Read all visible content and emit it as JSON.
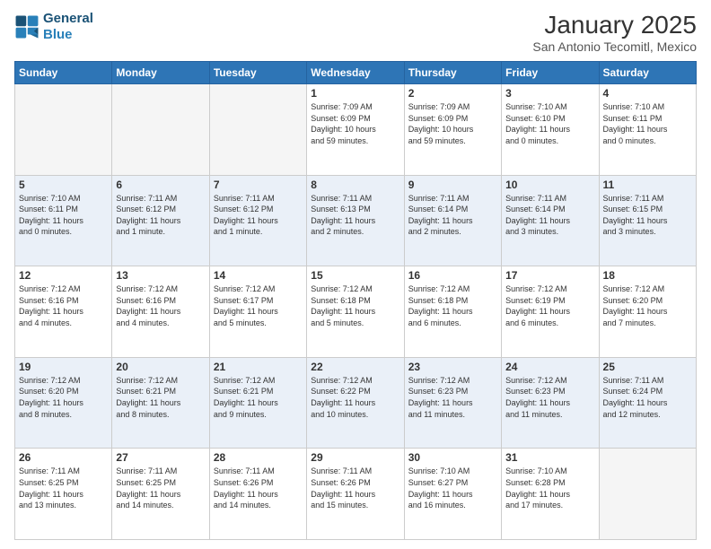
{
  "logo": {
    "line1": "General",
    "line2": "Blue"
  },
  "title": "January 2025",
  "subtitle": "San Antonio Tecomitl, Mexico",
  "weekdays": [
    "Sunday",
    "Monday",
    "Tuesday",
    "Wednesday",
    "Thursday",
    "Friday",
    "Saturday"
  ],
  "rows": [
    [
      {
        "day": "",
        "info": ""
      },
      {
        "day": "",
        "info": ""
      },
      {
        "day": "",
        "info": ""
      },
      {
        "day": "1",
        "info": "Sunrise: 7:09 AM\nSunset: 6:09 PM\nDaylight: 10 hours\nand 59 minutes."
      },
      {
        "day": "2",
        "info": "Sunrise: 7:09 AM\nSunset: 6:09 PM\nDaylight: 10 hours\nand 59 minutes."
      },
      {
        "day": "3",
        "info": "Sunrise: 7:10 AM\nSunset: 6:10 PM\nDaylight: 11 hours\nand 0 minutes."
      },
      {
        "day": "4",
        "info": "Sunrise: 7:10 AM\nSunset: 6:11 PM\nDaylight: 11 hours\nand 0 minutes."
      }
    ],
    [
      {
        "day": "5",
        "info": "Sunrise: 7:10 AM\nSunset: 6:11 PM\nDaylight: 11 hours\nand 0 minutes."
      },
      {
        "day": "6",
        "info": "Sunrise: 7:11 AM\nSunset: 6:12 PM\nDaylight: 11 hours\nand 1 minute."
      },
      {
        "day": "7",
        "info": "Sunrise: 7:11 AM\nSunset: 6:12 PM\nDaylight: 11 hours\nand 1 minute."
      },
      {
        "day": "8",
        "info": "Sunrise: 7:11 AM\nSunset: 6:13 PM\nDaylight: 11 hours\nand 2 minutes."
      },
      {
        "day": "9",
        "info": "Sunrise: 7:11 AM\nSunset: 6:14 PM\nDaylight: 11 hours\nand 2 minutes."
      },
      {
        "day": "10",
        "info": "Sunrise: 7:11 AM\nSunset: 6:14 PM\nDaylight: 11 hours\nand 3 minutes."
      },
      {
        "day": "11",
        "info": "Sunrise: 7:11 AM\nSunset: 6:15 PM\nDaylight: 11 hours\nand 3 minutes."
      }
    ],
    [
      {
        "day": "12",
        "info": "Sunrise: 7:12 AM\nSunset: 6:16 PM\nDaylight: 11 hours\nand 4 minutes."
      },
      {
        "day": "13",
        "info": "Sunrise: 7:12 AM\nSunset: 6:16 PM\nDaylight: 11 hours\nand 4 minutes."
      },
      {
        "day": "14",
        "info": "Sunrise: 7:12 AM\nSunset: 6:17 PM\nDaylight: 11 hours\nand 5 minutes."
      },
      {
        "day": "15",
        "info": "Sunrise: 7:12 AM\nSunset: 6:18 PM\nDaylight: 11 hours\nand 5 minutes."
      },
      {
        "day": "16",
        "info": "Sunrise: 7:12 AM\nSunset: 6:18 PM\nDaylight: 11 hours\nand 6 minutes."
      },
      {
        "day": "17",
        "info": "Sunrise: 7:12 AM\nSunset: 6:19 PM\nDaylight: 11 hours\nand 6 minutes."
      },
      {
        "day": "18",
        "info": "Sunrise: 7:12 AM\nSunset: 6:20 PM\nDaylight: 11 hours\nand 7 minutes."
      }
    ],
    [
      {
        "day": "19",
        "info": "Sunrise: 7:12 AM\nSunset: 6:20 PM\nDaylight: 11 hours\nand 8 minutes."
      },
      {
        "day": "20",
        "info": "Sunrise: 7:12 AM\nSunset: 6:21 PM\nDaylight: 11 hours\nand 8 minutes."
      },
      {
        "day": "21",
        "info": "Sunrise: 7:12 AM\nSunset: 6:21 PM\nDaylight: 11 hours\nand 9 minutes."
      },
      {
        "day": "22",
        "info": "Sunrise: 7:12 AM\nSunset: 6:22 PM\nDaylight: 11 hours\nand 10 minutes."
      },
      {
        "day": "23",
        "info": "Sunrise: 7:12 AM\nSunset: 6:23 PM\nDaylight: 11 hours\nand 11 minutes."
      },
      {
        "day": "24",
        "info": "Sunrise: 7:12 AM\nSunset: 6:23 PM\nDaylight: 11 hours\nand 11 minutes."
      },
      {
        "day": "25",
        "info": "Sunrise: 7:11 AM\nSunset: 6:24 PM\nDaylight: 11 hours\nand 12 minutes."
      }
    ],
    [
      {
        "day": "26",
        "info": "Sunrise: 7:11 AM\nSunset: 6:25 PM\nDaylight: 11 hours\nand 13 minutes."
      },
      {
        "day": "27",
        "info": "Sunrise: 7:11 AM\nSunset: 6:25 PM\nDaylight: 11 hours\nand 14 minutes."
      },
      {
        "day": "28",
        "info": "Sunrise: 7:11 AM\nSunset: 6:26 PM\nDaylight: 11 hours\nand 14 minutes."
      },
      {
        "day": "29",
        "info": "Sunrise: 7:11 AM\nSunset: 6:26 PM\nDaylight: 11 hours\nand 15 minutes."
      },
      {
        "day": "30",
        "info": "Sunrise: 7:10 AM\nSunset: 6:27 PM\nDaylight: 11 hours\nand 16 minutes."
      },
      {
        "day": "31",
        "info": "Sunrise: 7:10 AM\nSunset: 6:28 PM\nDaylight: 11 hours\nand 17 minutes."
      },
      {
        "day": "",
        "info": ""
      }
    ]
  ]
}
